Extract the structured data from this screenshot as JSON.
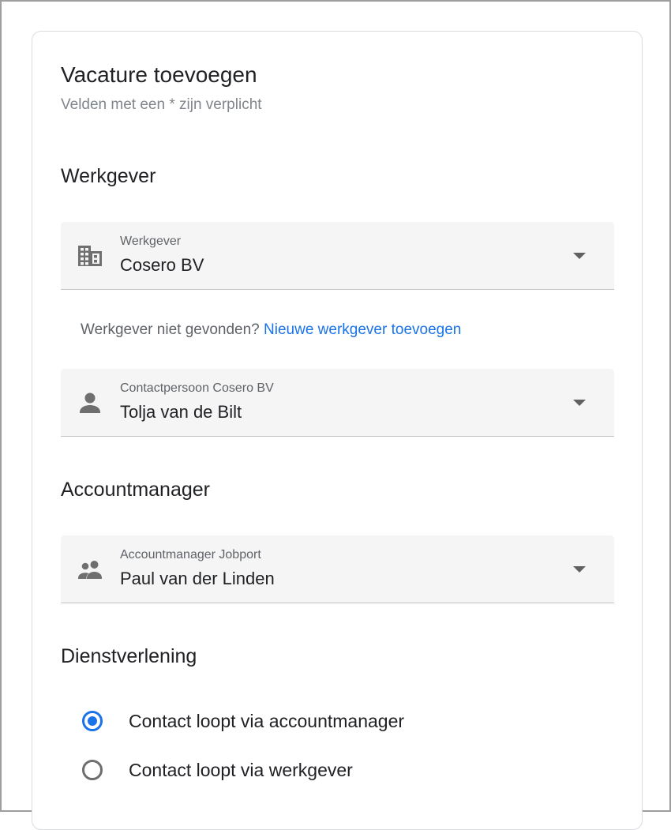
{
  "page": {
    "title": "Vacature toevoegen",
    "subtitle": "Velden met een * zijn verplicht"
  },
  "werkgever_section": {
    "heading": "Werkgever",
    "employer_field": {
      "label": "Werkgever",
      "value": "Cosero BV",
      "icon": "building-icon"
    },
    "hint_text": "Werkgever niet gevonden?",
    "hint_link": "Nieuwe werkgever toevoegen",
    "contact_field": {
      "label": "Contactpersoon Cosero BV",
      "value": "Tolja van de Bilt",
      "icon": "person-icon"
    }
  },
  "accountmanager_section": {
    "heading": "Accountmanager",
    "manager_field": {
      "label": "Accountmanager Jobport",
      "value": "Paul van der Linden",
      "icon": "people-icon"
    }
  },
  "dienstverlening_section": {
    "heading": "Dienstverlening",
    "options": [
      {
        "label": "Contact loopt via accountmanager",
        "selected": true
      },
      {
        "label": "Contact loopt via werkgever",
        "selected": false
      }
    ]
  },
  "colors": {
    "accent": "#1a73e8",
    "field_bg": "#f5f5f5",
    "muted_text": "#5f6368"
  }
}
